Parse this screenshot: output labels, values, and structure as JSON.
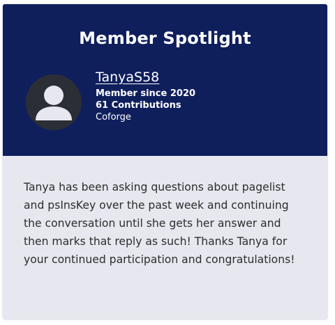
{
  "spotlight": {
    "title": "Member Spotlight",
    "member": {
      "username": "TanyaS58",
      "member_since": "Member since 2020",
      "contributions": "61 Contributions",
      "company": "Coforge",
      "avatar_icon": "user-avatar-icon"
    },
    "description": "Tanya has been asking questions about pagelist and psInsKey over the past week and continuing the conversation until she gets her answer and then marks that reply as such! Thanks Tanya for your continued participation and congratulations!"
  },
  "colors": {
    "header_bg": "#0f1f5c",
    "body_bg": "#e6e7ef",
    "avatar_bg": "#2b2f35",
    "avatar_figure": "#e6e7ef"
  }
}
